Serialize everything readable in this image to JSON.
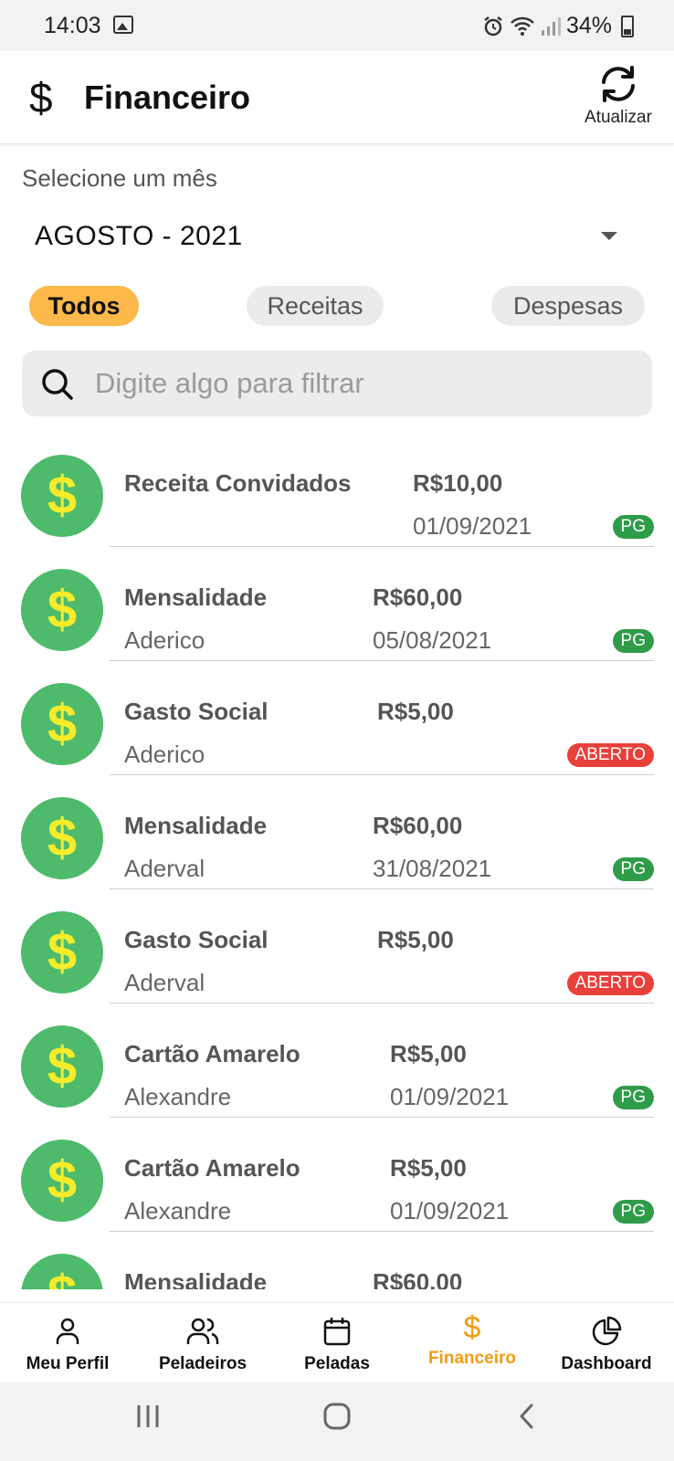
{
  "status_bar": {
    "time": "14:03",
    "battery": "34%",
    "icons": [
      "image-icon",
      "alarm-icon",
      "wifi-icon",
      "signal-icon",
      "battery-icon"
    ]
  },
  "header": {
    "icon": "dollar-icon",
    "title": "Financeiro",
    "refresh_label": "Atualizar"
  },
  "month": {
    "caption": "Selecione um mês",
    "selected": "AGOSTO - 2021"
  },
  "filters": {
    "todos": "Todos",
    "receitas": "Receitas",
    "despesas": "Despesas",
    "active": "todos"
  },
  "search": {
    "placeholder": "Digite algo para filtrar",
    "value": ""
  },
  "colors": {
    "accent": "#f39c12",
    "chip_active": "#fdb84a",
    "avatar": "#4dbb6b",
    "dollar": "#f7ec2a",
    "paid": "#2f9c4a",
    "open": "#e8403a"
  },
  "transactions": [
    {
      "title": "Receita Convidados",
      "subtitle": "",
      "amount": "R$10,00",
      "date": "01/09/2021",
      "status": "PG"
    },
    {
      "title": "Mensalidade",
      "subtitle": "Aderico",
      "amount": "R$60,00",
      "date": "05/08/2021",
      "status": "PG"
    },
    {
      "title": "Gasto Social",
      "subtitle": "Aderico",
      "amount": "R$5,00",
      "date": "",
      "status": "ABERTO"
    },
    {
      "title": "Mensalidade",
      "subtitle": "Aderval",
      "amount": "R$60,00",
      "date": "31/08/2021",
      "status": "PG"
    },
    {
      "title": "Gasto Social",
      "subtitle": "Aderval",
      "amount": "R$5,00",
      "date": "",
      "status": "ABERTO"
    },
    {
      "title": "Cartão Amarelo",
      "subtitle": "Alexandre",
      "amount": "R$5,00",
      "date": "01/09/2021",
      "status": "PG"
    },
    {
      "title": "Cartão Amarelo",
      "subtitle": "Alexandre",
      "amount": "R$5,00",
      "date": "01/09/2021",
      "status": "PG"
    },
    {
      "title": "Mensalidade",
      "subtitle": "",
      "amount": "R$60,00",
      "date": "",
      "status": ""
    }
  ],
  "bottom_nav": [
    {
      "label": "Meu Perfil",
      "icon": "user-icon"
    },
    {
      "label": "Peladeiros",
      "icon": "users-icon"
    },
    {
      "label": "Peladas",
      "icon": "calendar-icon"
    },
    {
      "label": "Financeiro",
      "icon": "dollar-icon",
      "active": true
    },
    {
      "label": "Dashboard",
      "icon": "pie-chart-icon"
    }
  ],
  "system_nav": [
    "recent-apps-icon",
    "home-icon",
    "back-icon"
  ]
}
